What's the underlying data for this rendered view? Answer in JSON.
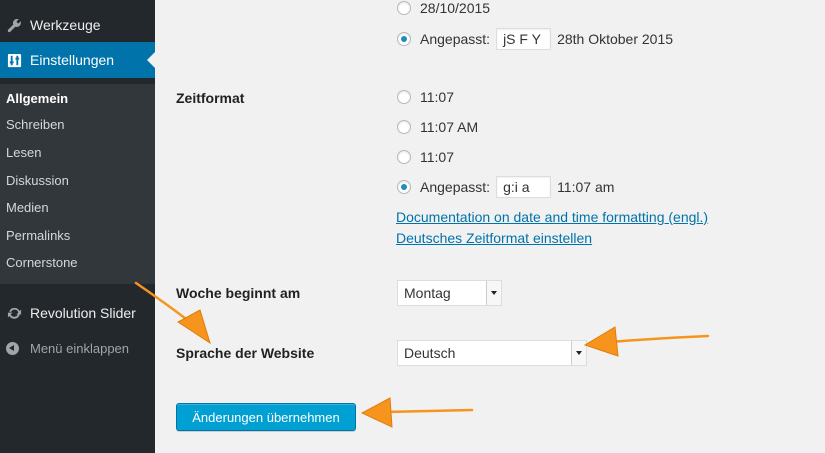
{
  "sidebar": {
    "items": [
      {
        "label": "Werkzeuge",
        "icon": "wrench-icon"
      },
      {
        "label": "Einstellungen",
        "icon": "settings-sliders-icon"
      }
    ],
    "submenu": [
      "Allgemein",
      "Schreiben",
      "Lesen",
      "Diskussion",
      "Medien",
      "Permalinks",
      "Cornerstone"
    ],
    "current_submenu": "Allgemein",
    "revolution": {
      "label": "Revolution Slider",
      "icon": "refresh-icon"
    },
    "collapse_label": "Menü einklappen"
  },
  "date_format": {
    "options": [
      {
        "label": "28/10/2015",
        "checked": false
      },
      {
        "label": "Angepasst:",
        "checked": true,
        "value": "jS F Y",
        "preview": "28th Oktober 2015"
      }
    ]
  },
  "time_format": {
    "label": "Zeitformat",
    "options": [
      {
        "label": "11:07",
        "checked": false
      },
      {
        "label": "11:07 AM",
        "checked": false
      },
      {
        "label": "11:07",
        "checked": false
      },
      {
        "label": "Angepasst:",
        "checked": true,
        "value": "g:i a",
        "preview": "11:07 am"
      }
    ],
    "links": [
      "Documentation on date and time formatting (engl.)",
      "Deutsches Zeitformat einstellen"
    ]
  },
  "week_start": {
    "label": "Woche beginnt am",
    "value": "Montag"
  },
  "site_language": {
    "label": "Sprache der Website",
    "value": "Deutsch"
  },
  "save_button": "Änderungen übernehmen",
  "colors": {
    "sidebar": "#23282d",
    "submenu": "#32373c",
    "accent": "#0073aa",
    "button": "#00a0d2",
    "arrow": "#f7941d"
  }
}
